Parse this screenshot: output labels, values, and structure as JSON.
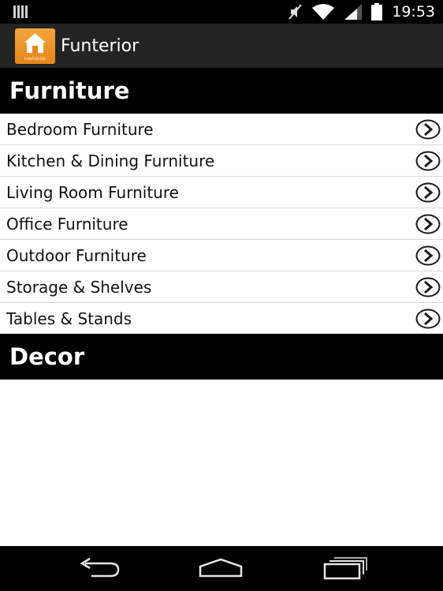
{
  "status_bar": {
    "time": "19:53",
    "icons": [
      "notification-icon",
      "mute-icon",
      "wifi-icon",
      "signal-icon",
      "battery-icon"
    ]
  },
  "action_bar": {
    "title": "Funterior",
    "icon_caption": "FUNTERIOR"
  },
  "sections": [
    {
      "title": "Furniture",
      "items": [
        {
          "label": "Bedroom Furniture"
        },
        {
          "label": "Kitchen & Dining Furniture"
        },
        {
          "label": "Living Room Furniture"
        },
        {
          "label": "Office Furniture"
        },
        {
          "label": "Outdoor Furniture"
        },
        {
          "label": "Storage & Shelves"
        },
        {
          "label": "Tables & Stands"
        }
      ]
    },
    {
      "title": "Decor",
      "items": []
    }
  ],
  "nav_bar": {
    "buttons": [
      "back-icon",
      "home-icon",
      "recent-apps-icon"
    ]
  },
  "colors": {
    "status_bar": "#000000",
    "action_bar": "#232323",
    "section_header": "#000000",
    "app_icon": "#f0a030",
    "divider": "#d8d8d8"
  }
}
